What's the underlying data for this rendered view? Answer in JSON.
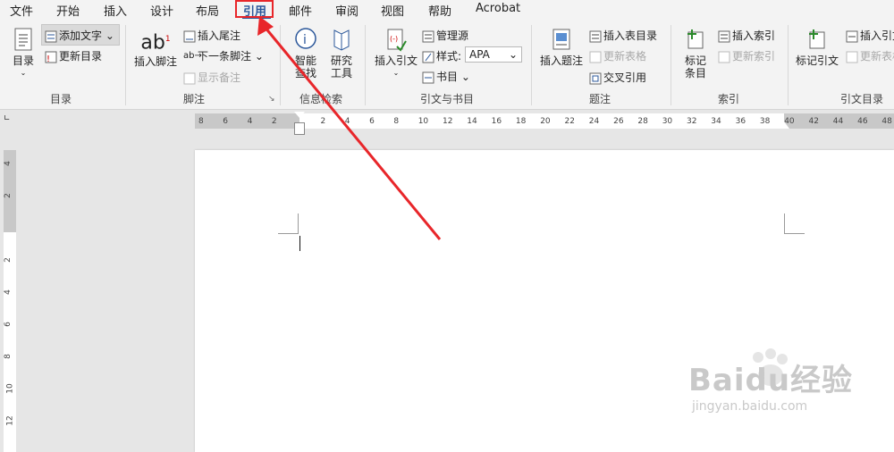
{
  "menubar": {
    "items": [
      "文件",
      "开始",
      "插入",
      "设计",
      "布局",
      "引用",
      "邮件",
      "审阅",
      "视图",
      "帮助",
      "Acrobat"
    ],
    "active_index": 5
  },
  "ribbon": {
    "toc_group": {
      "toc_button": "目录",
      "add_text": "添加文字",
      "update_toc": "更新目录",
      "label": "目录"
    },
    "footnotes_group": {
      "insert_footnote": "插入脚注",
      "insert_endnote": "插入尾注",
      "next_footnote": "下一条脚注",
      "show_notes": "显示备注",
      "label": "脚注"
    },
    "research_group": {
      "smart_lookup": "智能查找",
      "researcher": "研究工具",
      "label": "信息检索"
    },
    "citations_group": {
      "insert_citation": "插入引文",
      "manage_sources": "管理源",
      "style_label": "样式:",
      "style_value": "APA",
      "bibliography": "书目",
      "label": "引文与书目"
    },
    "captions_group": {
      "insert_caption": "插入题注",
      "insert_table_of_figures": "插入表目录",
      "update_table": "更新表格",
      "cross_reference": "交叉引用",
      "label": "题注"
    },
    "index_group": {
      "mark_entry": "标记条目",
      "insert_index": "插入索引",
      "update_index": "更新索引",
      "label": "索引"
    },
    "authorities_group": {
      "mark_citation": "标记引文",
      "insert_toa": "插入引文",
      "update_toa": "更新表格",
      "label": "引文目录"
    }
  },
  "ruler": {
    "h_ticks": [
      "8",
      "6",
      "4",
      "2",
      "",
      "2",
      "4",
      "6",
      "8",
      "10",
      "12",
      "14",
      "16",
      "18",
      "20",
      "22",
      "24",
      "26",
      "28",
      "30",
      "32",
      "34",
      "36",
      "38",
      "40",
      "42",
      "44",
      "46",
      "48"
    ],
    "v_ticks": [
      "4",
      "2",
      "",
      "2",
      "4",
      "6",
      "8",
      "10",
      "12"
    ]
  },
  "watermark": {
    "logo": "Baidu经验",
    "url": "jingyan.baidu.com"
  },
  "colors": {
    "accent": "#2b579a",
    "annotation_red": "#e8262a"
  }
}
